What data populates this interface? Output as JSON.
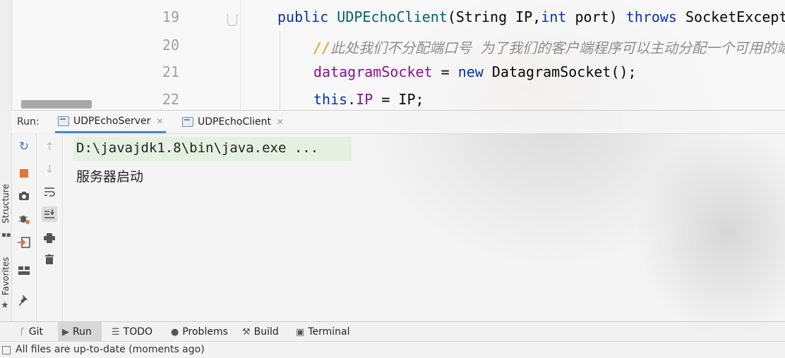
{
  "editor": {
    "line_numbers": [
      "19",
      "20",
      "21",
      "22"
    ],
    "lines": [
      [
        {
          "t": "public ",
          "c": "kw"
        },
        {
          "t": "UDPEchoClient",
          "c": "fn"
        },
        {
          "t": "(String IP,",
          "c": ""
        },
        {
          "t": "int",
          "c": "kw"
        },
        {
          "t": " port) ",
          "c": ""
        },
        {
          "t": "throws",
          "c": "kw"
        },
        {
          "t": " SocketException {",
          "c": ""
        }
      ],
      [
        {
          "t": "//",
          "c": "cmt-todo"
        },
        {
          "t": "此处我们不分配端口号 为了我们的客户端程序可以主动分配一个可用的端口",
          "c": "cmt"
        }
      ],
      [
        {
          "t": "datagramSocket",
          "c": "fld"
        },
        {
          "t": " = ",
          "c": ""
        },
        {
          "t": "new",
          "c": "kw"
        },
        {
          "t": " DatagramSocket();",
          "c": ""
        }
      ],
      [
        {
          "t": "this",
          "c": "kw"
        },
        {
          "t": ".",
          "c": ""
        },
        {
          "t": "IP",
          "c": "fld"
        },
        {
          "t": " = IP;",
          "c": ""
        }
      ]
    ]
  },
  "run_window": {
    "label": "Run:",
    "tabs": [
      {
        "label": "UDPEchoServer",
        "active": true
      },
      {
        "label": "UDPEchoClient",
        "active": false
      }
    ]
  },
  "console": {
    "command": "D:\\javajdk1.8\\bin\\java.exe ...",
    "output": "服务器启动"
  },
  "side_labels": {
    "structure": "Structure",
    "favorites": "Favorites"
  },
  "bottom_tabs": [
    {
      "label": "Git",
      "icon": "git-icon"
    },
    {
      "label": "Run",
      "icon": "run-icon",
      "active": true
    },
    {
      "label": "TODO",
      "icon": "todo-icon"
    },
    {
      "label": "Problems",
      "icon": "problems-icon"
    },
    {
      "label": "Build",
      "icon": "build-icon"
    },
    {
      "label": "Terminal",
      "icon": "terminal-icon"
    }
  ],
  "status_bar": {
    "message": "All files are up-to-date (moments ago)"
  },
  "colors": {
    "keyword": "#0033b3",
    "method": "#00627a",
    "field": "#871094",
    "comment": "#8c8c8c",
    "active_tab_underline": "#4a88c7"
  }
}
